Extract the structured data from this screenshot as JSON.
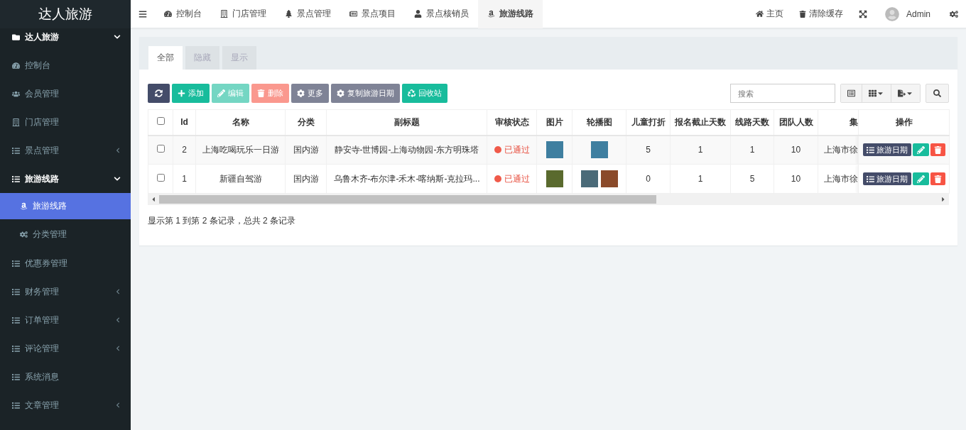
{
  "logo": {
    "title": "达人旅游"
  },
  "top_tabs": [
    {
      "label": "控制台",
      "selected": false
    },
    {
      "label": "门店管理",
      "selected": false
    },
    {
      "label": "景点管理",
      "selected": false
    },
    {
      "label": "景点项目",
      "selected": false
    },
    {
      "label": "景点核销员",
      "selected": false
    },
    {
      "label": "旅游线路",
      "selected": true
    }
  ],
  "top_right": {
    "home": "主页",
    "clear_cache": "清除缓存",
    "user": "Admin"
  },
  "sidebar": {
    "section": {
      "label": "达人旅游",
      "expanded": true
    },
    "items": [
      {
        "label": "控制台"
      },
      {
        "label": "会员管理"
      },
      {
        "label": "门店管理"
      },
      {
        "label": "景点管理",
        "expanded": false
      },
      {
        "label": "旅游线路",
        "expanded": true,
        "children": [
          {
            "label": "旅游线路",
            "selected": true
          },
          {
            "label": "分类管理",
            "selected": false
          }
        ]
      },
      {
        "label": "优惠券管理"
      },
      {
        "label": "财务管理",
        "expanded": false
      },
      {
        "label": "订单管理",
        "expanded": false
      },
      {
        "label": "评论管理",
        "expanded": false
      },
      {
        "label": "系统消息"
      },
      {
        "label": "文章管理",
        "expanded": false
      }
    ]
  },
  "filter_tabs": [
    {
      "label": "全部",
      "selected": true
    },
    {
      "label": "隐藏",
      "selected": false
    },
    {
      "label": "显示",
      "selected": false
    }
  ],
  "toolbar": [
    {
      "kind": "refresh",
      "disabled": false
    },
    {
      "kind": "add",
      "label": "添加",
      "disabled": false
    },
    {
      "kind": "edit",
      "label": "编辑",
      "disabled": true
    },
    {
      "kind": "delete",
      "label": "删除",
      "disabled": true
    },
    {
      "kind": "more",
      "label": "更多",
      "disabled": false
    },
    {
      "kind": "copy",
      "label": "复制旅游日期",
      "disabled": false
    },
    {
      "kind": "recycle",
      "label": "回收站",
      "disabled": false
    }
  ],
  "search": {
    "placeholder": "搜索"
  },
  "table": {
    "select_all_checked": false,
    "columns": [
      "Id",
      "名称",
      "分类",
      "副标题",
      "审核状态",
      "图片",
      "轮播图",
      "儿童打折",
      "报名截止天数",
      "线路天数",
      "团队人数",
      "集",
      "操作"
    ],
    "rows": [
      {
        "checked": false,
        "id": "2",
        "name": "上海吃喝玩乐一日游",
        "category": "国内游",
        "subtitle": "静安寺-世博园-上海动物园-东方明珠塔",
        "status": {
          "label": "已通过",
          "color": "#f05a4a"
        },
        "images": [
          {
            "color": "#3f7fa0"
          }
        ],
        "carousel": [
          {
            "color": "#3f7fa0"
          }
        ],
        "child_discount": "5",
        "signup_deadline_days": "1",
        "route_days": "1",
        "team_size": "10",
        "column_12": "上海市徐",
        "date_button": "旅游日期"
      },
      {
        "checked": false,
        "id": "1",
        "name": "新疆自驾游",
        "category": "国内游",
        "subtitle": "乌鲁木齐-布尔津-禾木-喀纳斯-克拉玛...",
        "status": {
          "label": "已通过",
          "color": "#f05a4a"
        },
        "images": [
          {
            "color": "#5a6a2e"
          }
        ],
        "carousel": [
          {
            "color": "#4a6a78"
          },
          {
            "color": "#8a4a2a"
          }
        ],
        "child_discount": "0",
        "signup_deadline_days": "1",
        "route_days": "5",
        "team_size": "10",
        "column_12": "上海市徐",
        "date_button": "旅游日期"
      }
    ]
  },
  "pagination": {
    "summary": "显示第 1 到第 2 条记录，总共 2 条记录"
  }
}
